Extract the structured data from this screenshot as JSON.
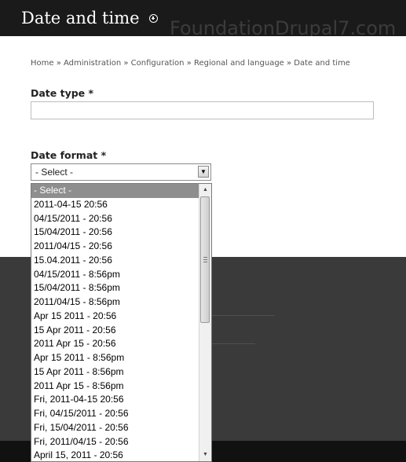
{
  "header": {
    "title": "Date and time",
    "watermark": "FoundationDrupal7.com"
  },
  "breadcrumb": "Home » Administration » Configuration » Regional and language » Date and time",
  "form": {
    "date_type_label": "Date type *",
    "date_type_value": "",
    "date_format_label": "Date format *",
    "date_format_selected": "- Select -"
  },
  "icons": {
    "shortcut": "add-shortcut-icon",
    "dropdown_arrow": "chevron-down-icon",
    "scroll_up": "scroll-up-icon",
    "scroll_down": "scroll-down-icon"
  },
  "dropdown": {
    "scroll_fraction": 0.0,
    "visible_fraction": 0.5,
    "options": [
      "- Select -",
      "2011-04-15 20:56",
      "04/15/2011 - 20:56",
      "15/04/2011 - 20:56",
      "2011/04/15 - 20:56",
      "15.04.2011 - 20:56",
      "04/15/2011 - 8:56pm",
      "15/04/2011 - 8:56pm",
      "2011/04/15 - 8:56pm",
      "Apr 15 2011 - 20:56",
      "15 Apr 2011 - 20:56",
      "2011 Apr 15 - 20:56",
      "Apr 15 2011 - 8:56pm",
      "15 Apr 2011 - 8:56pm",
      "2011 Apr 15 - 8:56pm",
      "Fri, 2011-04-15 20:56",
      "Fri, 04/15/2011 - 20:56",
      "Fri, 15/04/2011 - 20:56",
      "Fri, 2011/04/15 - 20:56",
      "April 15, 2011 - 20:56"
    ]
  },
  "colors": {
    "header_bg": "#1a1a1a",
    "highlight": "#8e8e8e",
    "band": "#3a3a3a"
  }
}
